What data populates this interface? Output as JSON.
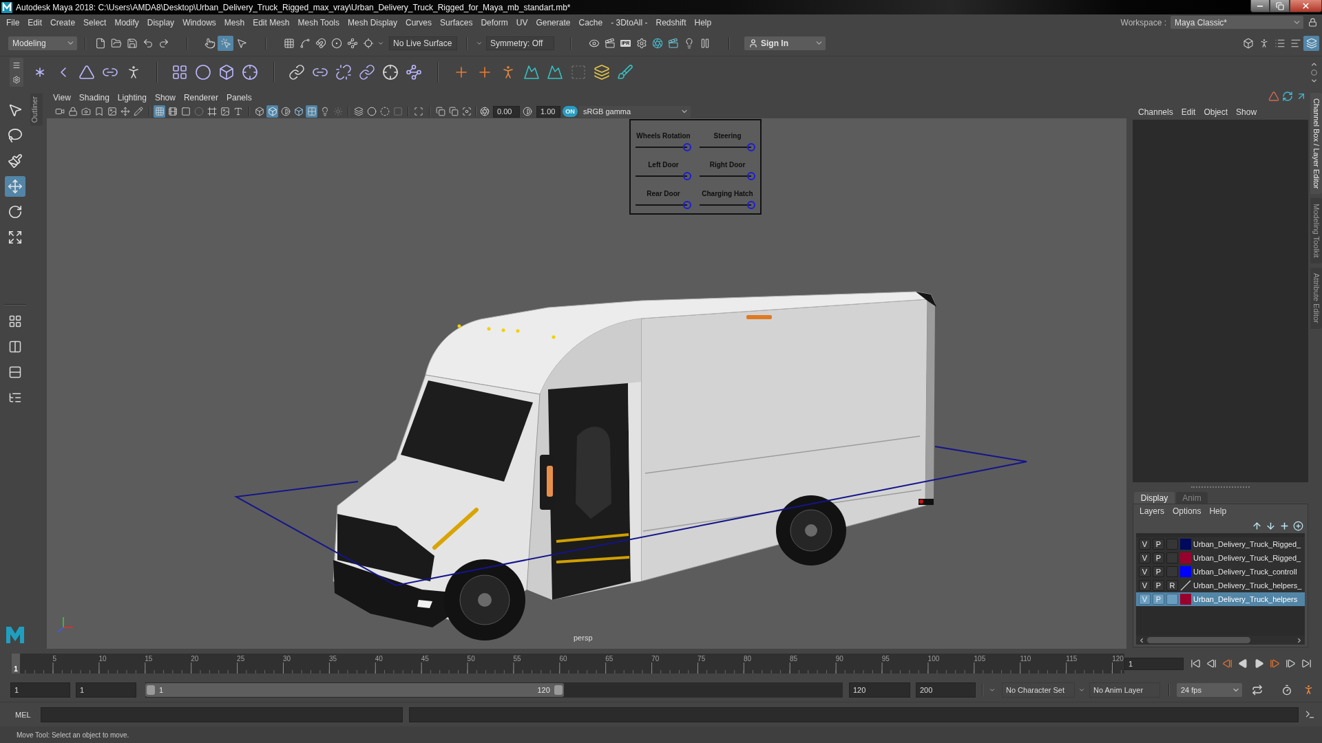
{
  "window": {
    "title": "Autodesk Maya 2018: C:\\Users\\AMDA8\\Desktop\\Urban_Delivery_Truck_Rigged_max_vray\\Urban_Delivery_Truck_Rigged_for_Maya_mb_standart.mb*"
  },
  "menu_bar": {
    "items": [
      "File",
      "Edit",
      "Create",
      "Select",
      "Modify",
      "Display",
      "Windows",
      "Mesh",
      "Edit Mesh",
      "Mesh Tools",
      "Mesh Display",
      "Curves",
      "Surfaces",
      "Deform",
      "UV",
      "Generate",
      "Cache",
      "- 3DtoAll -",
      "Redshift",
      "Help"
    ],
    "workspace": {
      "label": "Workspace :",
      "value": "Maya Classic*"
    }
  },
  "status_line": {
    "menu_set": "Modeling",
    "selection_masks": [
      {
        "on": false
      },
      {
        "on": true
      },
      {
        "on": false
      }
    ],
    "live_surface": "No Live Surface",
    "symmetry": "Symmetry: Off",
    "ipr_label": "IPR",
    "sign_in": "Sign In",
    "panel_toggles": [
      {
        "on": false
      },
      {
        "on": false
      },
      {
        "on": false
      },
      {
        "on": false
      },
      {
        "on": true
      }
    ]
  },
  "tool_box": {
    "tools": [
      {
        "selected": false
      },
      {
        "selected": false
      },
      {
        "selected": false
      },
      {
        "selected": true
      },
      {
        "selected": false
      },
      {
        "selected": false
      }
    ]
  },
  "outliner_tab": {
    "label": "Outliner"
  },
  "viewport": {
    "menu": [
      "View",
      "Shading",
      "Lighting",
      "Show",
      "Renderer",
      "Panels"
    ],
    "toolbar": [
      {
        "on": false,
        "disabled": false
      },
      {
        "on": false,
        "disabled": false
      },
      {
        "on": false,
        "disabled": false
      },
      {
        "on": false,
        "disabled": false
      },
      {
        "on": false,
        "disabled": false
      },
      {
        "on": false,
        "disabled": false
      },
      {
        "on": false,
        "disabled": false
      },
      {
        "on": true,
        "disabled": false
      },
      {
        "on": false,
        "disabled": false
      },
      {
        "on": false,
        "disabled": false
      },
      {
        "on": false,
        "disabled": true
      },
      {
        "on": false,
        "disabled": false
      },
      {
        "on": false,
        "disabled": false
      },
      {
        "on": false,
        "disabled": false
      },
      {
        "on": false,
        "disabled": false
      },
      {
        "on": true,
        "disabled": false
      },
      {
        "on": false,
        "disabled": false
      },
      {
        "on": false,
        "disabled": false
      },
      {
        "on": true,
        "disabled": false
      },
      {
        "on": false,
        "disabled": false
      },
      {
        "on": false,
        "disabled": true
      },
      {
        "on": false,
        "disabled": false
      },
      {
        "on": false,
        "disabled": false
      },
      {
        "on": false,
        "disabled": false
      },
      {
        "on": false,
        "disabled": true
      },
      {
        "on": false,
        "disabled": false
      },
      {
        "on": false,
        "disabled": false
      },
      {
        "on": false,
        "disabled": false
      },
      {
        "on": false,
        "disabled": false
      }
    ],
    "exposure": "0.00",
    "gamma": "1.00",
    "color_management": {
      "label": "ON",
      "on": true
    },
    "color_space": "sRGB gamma",
    "camera": "persp",
    "control_board": {
      "sliders": [
        {
          "label": "Wheels Rotation",
          "level": 1
        },
        {
          "label": "Steering",
          "level": 1
        },
        {
          "label": "Left Door",
          "level": 1
        },
        {
          "label": "Right Door",
          "level": 1
        },
        {
          "label": "Rear Door",
          "level": 1
        },
        {
          "label": "Charging Hatch",
          "level": 1
        }
      ]
    }
  },
  "channel_box": {
    "menu": [
      "Channels",
      "Edit",
      "Object",
      "Show"
    ]
  },
  "layer_editor": {
    "tabs": [
      {
        "label": "Display",
        "selected": true
      },
      {
        "label": "Anim",
        "selected": false
      }
    ],
    "menu": [
      "Layers",
      "Options",
      "Help"
    ],
    "layers": [
      {
        "visible": "V",
        "playback": "P",
        "color": "#000a5c",
        "name": "Urban_Delivery_Truck_Rigged_",
        "selected": false
      },
      {
        "visible": "V",
        "playback": "P",
        "color": "#99002e",
        "name": "Urban_Delivery_Truck_Rigged_",
        "selected": false
      },
      {
        "visible": "V",
        "playback": "P",
        "color": "#0000ff",
        "name": "Urban_Delivery_Truck_controll",
        "selected": false
      },
      {
        "visible": "V",
        "playback": "P",
        "display_type": "R",
        "name": "Urban_Delivery_Truck_helpers_",
        "selected": false
      },
      {
        "visible": "V",
        "playback": "P",
        "color": "#99002e",
        "name": "Urban_Delivery_Truck_helpers",
        "selected": true
      }
    ]
  },
  "side_tabs": [
    {
      "label": "Channel Box / Layer Editor",
      "selected": true
    },
    {
      "label": "Modeling Toolkit",
      "selected": false
    },
    {
      "label": "Attribute Editor",
      "selected": false
    }
  ],
  "time_slider": {
    "current_frame": "1",
    "level": 0,
    "ticks": [
      "5",
      "10",
      "15",
      "20",
      "25",
      "30",
      "35",
      "40",
      "45",
      "50",
      "55",
      "60",
      "65",
      "70",
      "75",
      "80",
      "85",
      "90",
      "95",
      "100",
      "105",
      "110",
      "115",
      "120"
    ],
    "frame_field": "1"
  },
  "range_slider": {
    "animation_start": "1",
    "playback_start": "1",
    "range": {
      "start": "1",
      "end": "120",
      "level": 0.6
    },
    "playback_end": "120",
    "animation_end": "200",
    "character_set": "No Character Set",
    "anim_layer": "No Anim Layer",
    "fps": "24 fps"
  },
  "command_line": {
    "language": "MEL"
  },
  "help_line": "Move Tool: Select an object to move."
}
